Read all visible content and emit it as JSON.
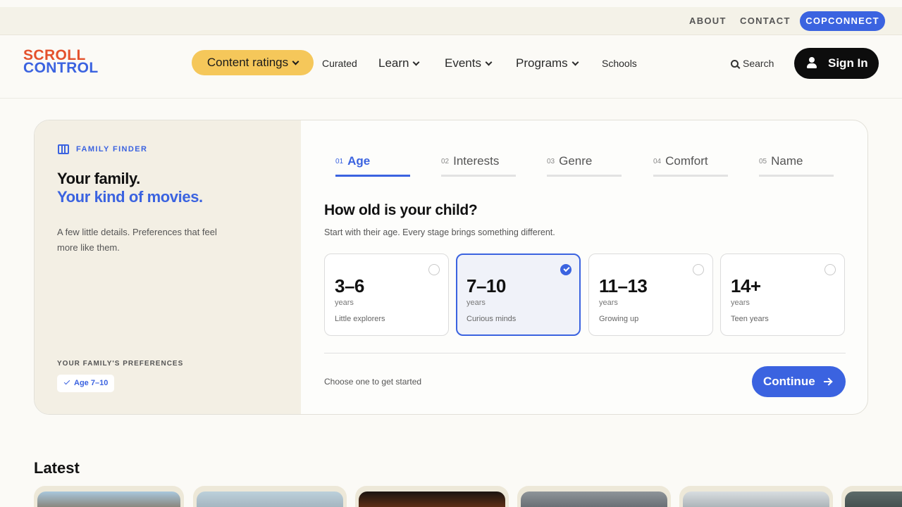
{
  "utility_nav": {
    "about": "ABOUT",
    "contact": "CONTACT",
    "copconnect": "COPCONNECT"
  },
  "logo": {
    "line1": "SCROLL",
    "line2": "CONTROL"
  },
  "nav": {
    "content_ratings": "Content ratings",
    "curated": "Curated",
    "learn": "Learn",
    "events": "Events",
    "programs": "Programs",
    "schools": "Schools",
    "search": "Search",
    "sign_in": "Sign In"
  },
  "finder": {
    "label": "FAMILY FINDER",
    "headline_1": "Your family.",
    "headline_2": "Your kind of movies.",
    "lead": "A few little details. Preferences that feel more like them.",
    "prefs_label": "YOUR FAMILY'S PREFERENCES",
    "pref_chip": "Age 7–10"
  },
  "steps": [
    {
      "num": "01",
      "label": "Age",
      "active": true
    },
    {
      "num": "02",
      "label": "Interests",
      "active": false
    },
    {
      "num": "03",
      "label": "Genre",
      "active": false
    },
    {
      "num": "04",
      "label": "Comfort",
      "active": false
    },
    {
      "num": "05",
      "label": "Name",
      "active": false
    }
  ],
  "question": {
    "title": "How old is your child?",
    "subtitle": "Start with their age. Every stage brings something different."
  },
  "age_options": [
    {
      "range": "3–6",
      "unit": "years",
      "desc": "Little explorers",
      "selected": false
    },
    {
      "range": "7–10",
      "unit": "years",
      "desc": "Curious minds",
      "selected": true
    },
    {
      "range": "11–13",
      "unit": "years",
      "desc": "Growing up",
      "selected": false
    },
    {
      "range": "14+",
      "unit": "years",
      "desc": "Teen years",
      "selected": false
    }
  ],
  "footer": {
    "hint": "Choose one to get started",
    "continue": "Continue"
  },
  "latest": {
    "title": "Latest"
  },
  "colors": {
    "accent": "#3b63e0",
    "ratings_pill": "#f5c75a",
    "panel_bg": "#f3efe4",
    "logo_top": "#e4512c"
  }
}
